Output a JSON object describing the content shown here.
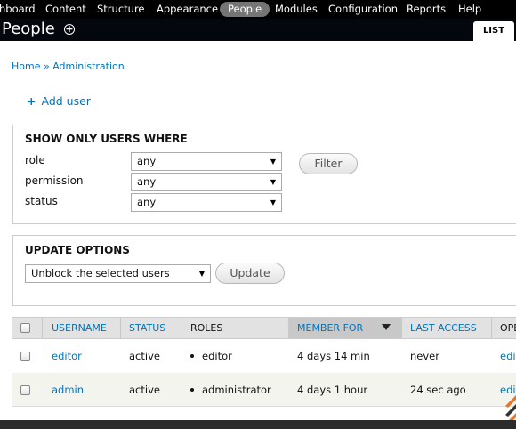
{
  "toolbar": {
    "items": [
      "hboard",
      "Content",
      "Structure",
      "Appearance",
      "People",
      "Modules",
      "Configuration",
      "Reports",
      "Help"
    ]
  },
  "title": {
    "page": "People",
    "tab": "LIST"
  },
  "breadcrumb": {
    "home": "Home",
    "sep": "»",
    "admin": "Administration"
  },
  "actions": {
    "add_user": "Add user"
  },
  "filter": {
    "legend": "SHOW ONLY USERS WHERE",
    "fields": [
      {
        "label": "role",
        "value": "any"
      },
      {
        "label": "permission",
        "value": "any"
      },
      {
        "label": "status",
        "value": "any"
      }
    ],
    "button": "Filter"
  },
  "update": {
    "legend": "UPDATE OPTIONS",
    "selected": "Unblock the selected users",
    "button": "Update"
  },
  "table": {
    "columns": [
      "USERNAME",
      "STATUS",
      "ROLES",
      "MEMBER FOR",
      "LAST ACCESS",
      "OPE"
    ],
    "rows": [
      {
        "username": "editor",
        "status": "active",
        "role": "editor",
        "member_for": "4 days 14 min",
        "last_access": "never",
        "op": "edit"
      },
      {
        "username": "admin",
        "status": "active",
        "role": "administrator",
        "member_for": "4 days 1 hour",
        "last_access": "24 sec ago",
        "op": "edit"
      }
    ]
  },
  "colors": {
    "link": "#0074bd",
    "toolbar_bg": "#000000",
    "active_pill": "#757575"
  }
}
